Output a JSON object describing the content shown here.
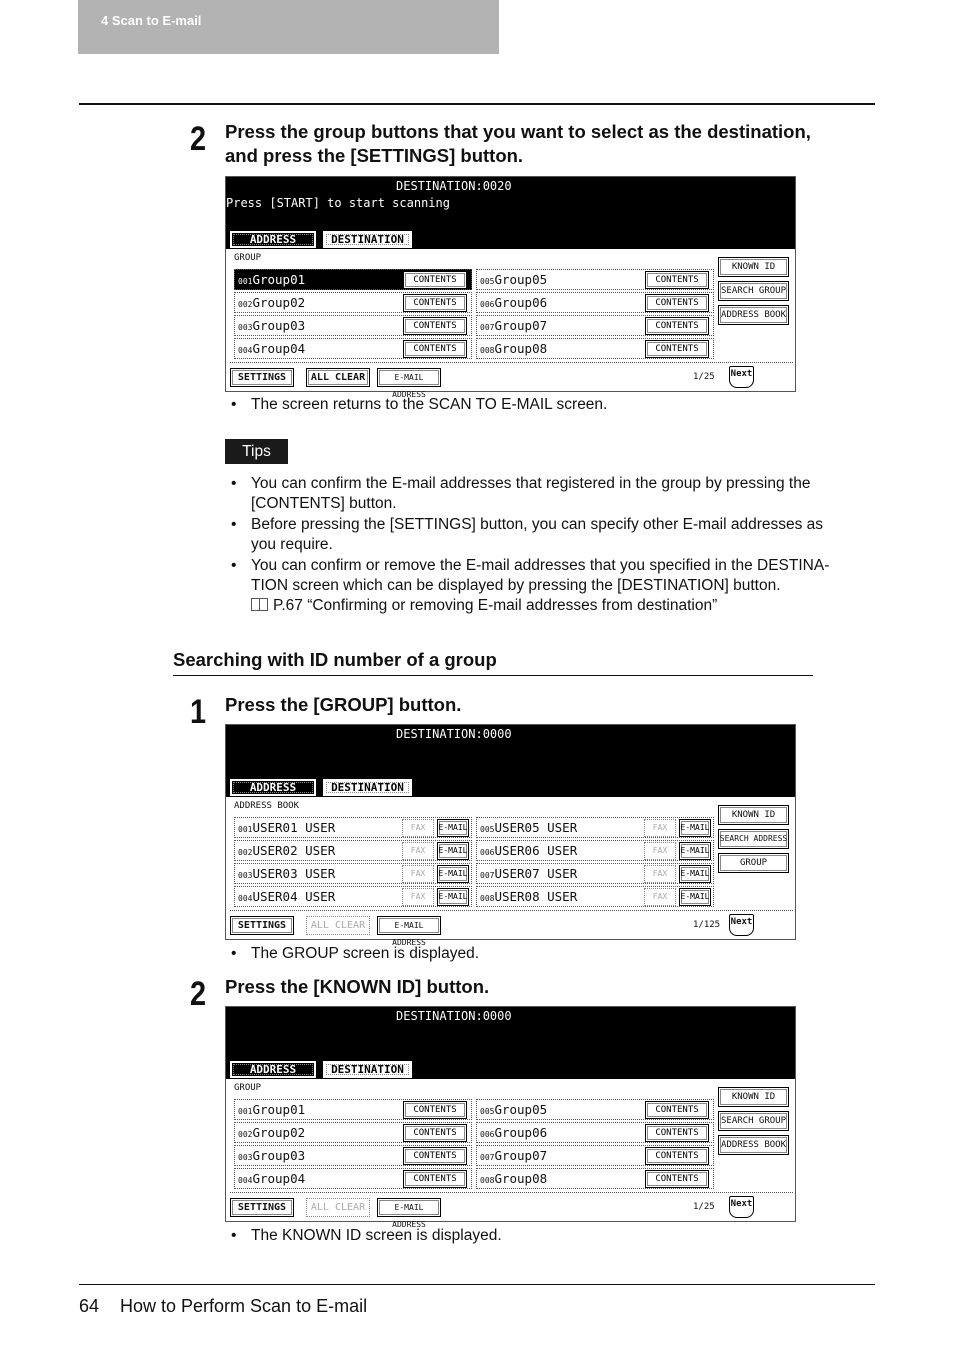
{
  "header": {
    "chapter_label": "4   Scan to E-mail"
  },
  "step2a": {
    "number": "2",
    "line1": "Press the group buttons that you want to select as the destination,",
    "line2": "and press the [SETTINGS] button.",
    "result": "The screen returns to the SCAN TO E-MAIL screen."
  },
  "tips": {
    "badge": "Tips",
    "items": [
      {
        "line1": "You can confirm the E-mail addresses that registered in the group by pressing the",
        "line2": "[CONTENTS] button."
      },
      {
        "line1": "Before pressing the [SETTINGS] button, you can specify other E-mail addresses as",
        "line2": "you require."
      },
      {
        "line1": "You can confirm or remove the E-mail addresses that you specified in the DESTINA-",
        "line2": "TION screen which can be displayed by pressing the [DESTINATION] button."
      }
    ],
    "reference": "P.67 “Confirming or removing E-mail addresses from destination”"
  },
  "section": {
    "heading": "Searching with ID number of a group"
  },
  "step1": {
    "number": "1",
    "text": "Press the [GROUP] button.",
    "result": "The GROUP screen is displayed."
  },
  "step2b": {
    "number": "2",
    "text": "Press the [KNOWN ID] button.",
    "result": "The KNOWN ID screen is displayed."
  },
  "panels": {
    "tab_address": "ADDRESS",
    "tab_destination": "DESTINATION",
    "settings": "SETTINGS",
    "all_clear": "ALL CLEAR",
    "email_address": "E-MAIL ADDRESS",
    "next": "Next",
    "contents": "CONTENTS",
    "fax": "FAX",
    "email": "E-MAIL",
    "known_id": "KNOWN ID",
    "search_group": "SEARCH GROUP",
    "search_address": "SEARCH ADDRESS",
    "address_book": "ADDRESS BOOK",
    "group": "GROUP",
    "p1": {
      "destination": "DESTINATION:0020",
      "message": "Press [START] to start scanning",
      "list_label": "GROUP",
      "page": "1/25",
      "groups": [
        {
          "idx": "001",
          "name": "Group01"
        },
        {
          "idx": "002",
          "name": "Group02"
        },
        {
          "idx": "003",
          "name": "Group03"
        },
        {
          "idx": "004",
          "name": "Group04"
        },
        {
          "idx": "005",
          "name": "Group05"
        },
        {
          "idx": "006",
          "name": "Group06"
        },
        {
          "idx": "007",
          "name": "Group07"
        },
        {
          "idx": "008",
          "name": "Group08"
        }
      ]
    },
    "p2": {
      "destination": "DESTINATION:0000",
      "list_label": "ADDRESS BOOK",
      "page": "1/125",
      "users": [
        {
          "idx": "001",
          "name": "USER01 USER"
        },
        {
          "idx": "002",
          "name": "USER02 USER"
        },
        {
          "idx": "003",
          "name": "USER03 USER"
        },
        {
          "idx": "004",
          "name": "USER04 USER"
        },
        {
          "idx": "005",
          "name": "USER05 USER"
        },
        {
          "idx": "006",
          "name": "USER06 USER"
        },
        {
          "idx": "007",
          "name": "USER07 USER"
        },
        {
          "idx": "008",
          "name": "USER08 USER"
        }
      ]
    },
    "p3": {
      "destination": "DESTINATION:0000",
      "list_label": "GROUP",
      "page": "1/25",
      "groups": [
        {
          "idx": "001",
          "name": "Group01"
        },
        {
          "idx": "002",
          "name": "Group02"
        },
        {
          "idx": "003",
          "name": "Group03"
        },
        {
          "idx": "004",
          "name": "Group04"
        },
        {
          "idx": "005",
          "name": "Group05"
        },
        {
          "idx": "006",
          "name": "Group06"
        },
        {
          "idx": "007",
          "name": "Group07"
        },
        {
          "idx": "008",
          "name": "Group08"
        }
      ]
    }
  },
  "footer": {
    "page_number": "64",
    "title": "How to Perform Scan to E-mail"
  }
}
